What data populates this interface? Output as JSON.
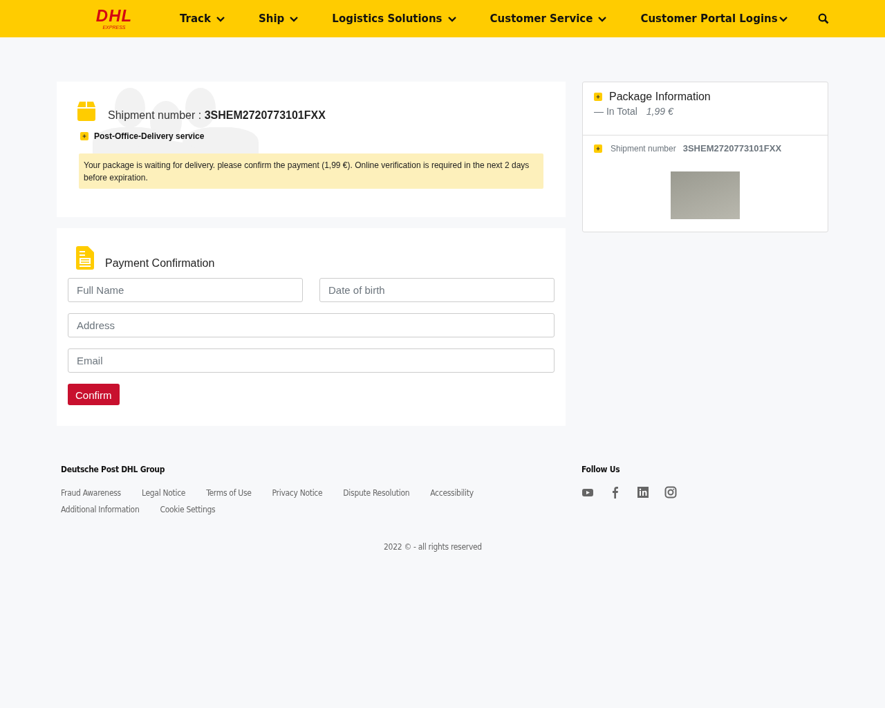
{
  "header": {
    "logo": {
      "wordmark": "DHL",
      "tagline": "EXPRESS"
    },
    "nav": [
      {
        "label": "Track"
      },
      {
        "label": "Ship"
      },
      {
        "label": "Logistics Solutions"
      },
      {
        "label": "Customer Service"
      },
      {
        "label": "Customer Portal Logins"
      }
    ]
  },
  "shipment_card": {
    "label": "Shipment number :",
    "number": "3SHEM2720773101FXX",
    "service": "Post-Office-Delivery service",
    "notice": "Your package is waiting for delivery. please confirm the payment (1,99 €). Online verification is required in the next 2 days before expiration."
  },
  "payment_form": {
    "title": "Payment Confirmation",
    "fields": [
      {
        "placeholder": "Full Name"
      },
      {
        "placeholder": "Date of birth"
      },
      {
        "placeholder": "Address"
      },
      {
        "placeholder": "Email"
      }
    ],
    "button": "Confirm"
  },
  "package_info": {
    "title": "Package Information",
    "total_label": "— In Total",
    "total": "1,99 €",
    "shipment_label": "Shipment number",
    "shipment_number": "3SHEM2720773101FXX"
  },
  "footer": {
    "group": "Deutsche Post DHL Group",
    "links": [
      {
        "label": "Fraud Awareness"
      },
      {
        "label": "Legal Notice"
      },
      {
        "label": "Terms of Use"
      },
      {
        "label": "Privacy Notice"
      },
      {
        "label": "Dispute Resolution"
      },
      {
        "label": "Accessibility"
      },
      {
        "label": "Additional Information"
      },
      {
        "label": "Cookie Settings"
      }
    ],
    "follow": "Follow Us",
    "social": [
      {
        "kind": "youtube"
      },
      {
        "kind": "facebook"
      },
      {
        "kind": "linkedin"
      },
      {
        "kind": "instagram"
      }
    ],
    "copyright": "2022 © - all rights reserved"
  }
}
